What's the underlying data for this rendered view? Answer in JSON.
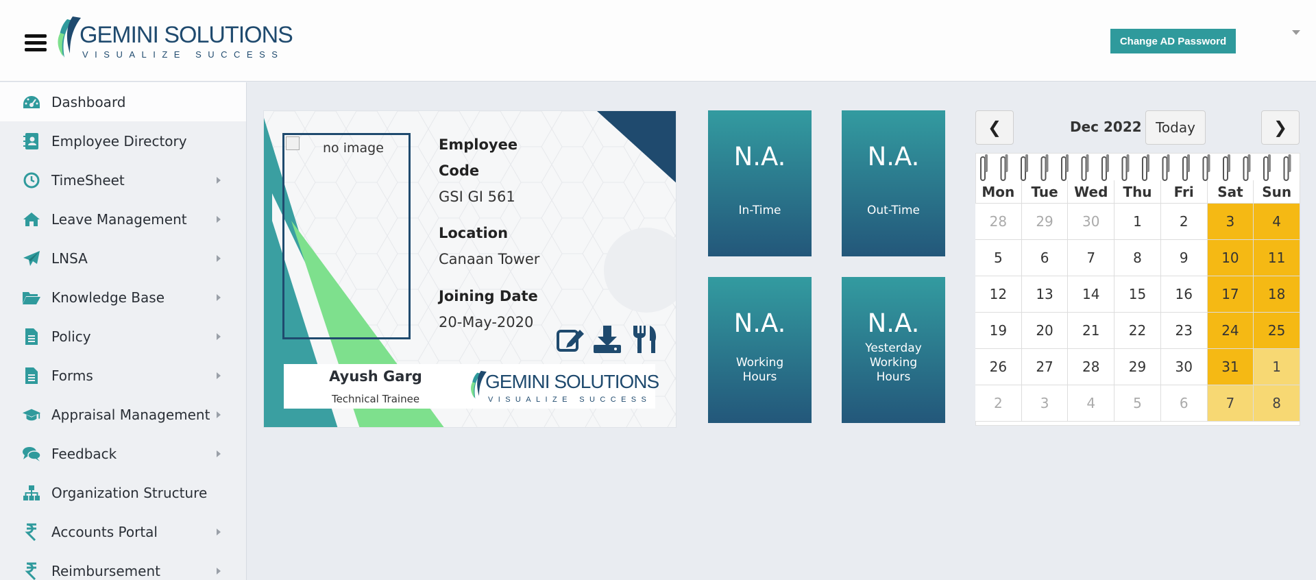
{
  "header": {
    "brand_name_1": "GEMINI",
    "brand_name_2": "SOLUTIONS",
    "tagline": "VISUALIZE SUCCESS",
    "change_password_label": "Change AD Password"
  },
  "sidebar": {
    "items": [
      {
        "label": "Dashboard",
        "icon": "dashboard-icon",
        "active": true,
        "has_submenu": false
      },
      {
        "label": "Employee Directory",
        "icon": "contact-book-icon",
        "has_submenu": false
      },
      {
        "label": "TimeSheet",
        "icon": "clock-icon",
        "has_submenu": true
      },
      {
        "label": "Leave Management",
        "icon": "home-icon",
        "has_submenu": true
      },
      {
        "label": "LNSA",
        "icon": "paper-plane-icon",
        "has_submenu": true
      },
      {
        "label": "Knowledge Base",
        "icon": "folder-open-icon",
        "has_submenu": true
      },
      {
        "label": "Policy",
        "icon": "document-icon",
        "has_submenu": true
      },
      {
        "label": "Forms",
        "icon": "document-icon",
        "has_submenu": true
      },
      {
        "label": "Appraisal Management",
        "icon": "graduation-cap-icon",
        "has_submenu": true
      },
      {
        "label": "Feedback",
        "icon": "chat-bubbles-icon",
        "has_submenu": true
      },
      {
        "label": "Organization Structure",
        "icon": "org-chart-icon",
        "has_submenu": false
      },
      {
        "label": "Accounts Portal",
        "icon": "rupee-icon",
        "has_submenu": true
      },
      {
        "label": "Reimbursement",
        "icon": "rupee-icon",
        "has_submenu": true
      }
    ]
  },
  "idcard": {
    "photo_alt": "no image",
    "employee_code_label_1": "Employee",
    "employee_code_label_2": "Code",
    "employee_code": "GSI GI 561",
    "location_label": "Location",
    "location": "Canaan Tower",
    "joining_label": "Joining Date",
    "joining_date": "20-May-2020",
    "name": "Ayush Garg",
    "role": "Technical Trainee",
    "logo_name_1": "GEMINI",
    "logo_name_2": "SOLUTIONS",
    "logo_tagline": "VISUALIZE SUCCESS"
  },
  "tiles": {
    "in_time": {
      "value": "N.A.",
      "label": "In-Time"
    },
    "out_time": {
      "value": "N.A.",
      "label": "Out-Time"
    },
    "working_hours": {
      "value": "N.A.",
      "label_1": "Working",
      "label_2": "Hours"
    },
    "yesterday_hours": {
      "value": "N.A.",
      "label_1": "Yesterday",
      "label_2": "Working",
      "label_3": "Hours"
    }
  },
  "calendar": {
    "prev": "❮",
    "next": "❯",
    "title": "Dec 2022",
    "today_label": "Today",
    "weekdays": [
      "Mon",
      "Tue",
      "Wed",
      "Thu",
      "Fri",
      "Sat",
      "Sun"
    ],
    "weeks": [
      [
        "28",
        "29",
        "30",
        "1",
        "2",
        "3",
        "4"
      ],
      [
        "5",
        "6",
        "7",
        "8",
        "9",
        "10",
        "11"
      ],
      [
        "12",
        "13",
        "14",
        "15",
        "16",
        "17",
        "18"
      ],
      [
        "19",
        "20",
        "21",
        "22",
        "23",
        "24",
        "25"
      ],
      [
        "26",
        "27",
        "28",
        "29",
        "30",
        "31",
        "1"
      ],
      [
        "2",
        "3",
        "4",
        "5",
        "6",
        "7",
        "8"
      ]
    ],
    "weekend_color": "#f5b914",
    "weekend_other_color": "#f7d873"
  },
  "colors": {
    "teal": "#2f9a9c",
    "navy": "#1f4a6e",
    "green": "#7ee08d"
  }
}
